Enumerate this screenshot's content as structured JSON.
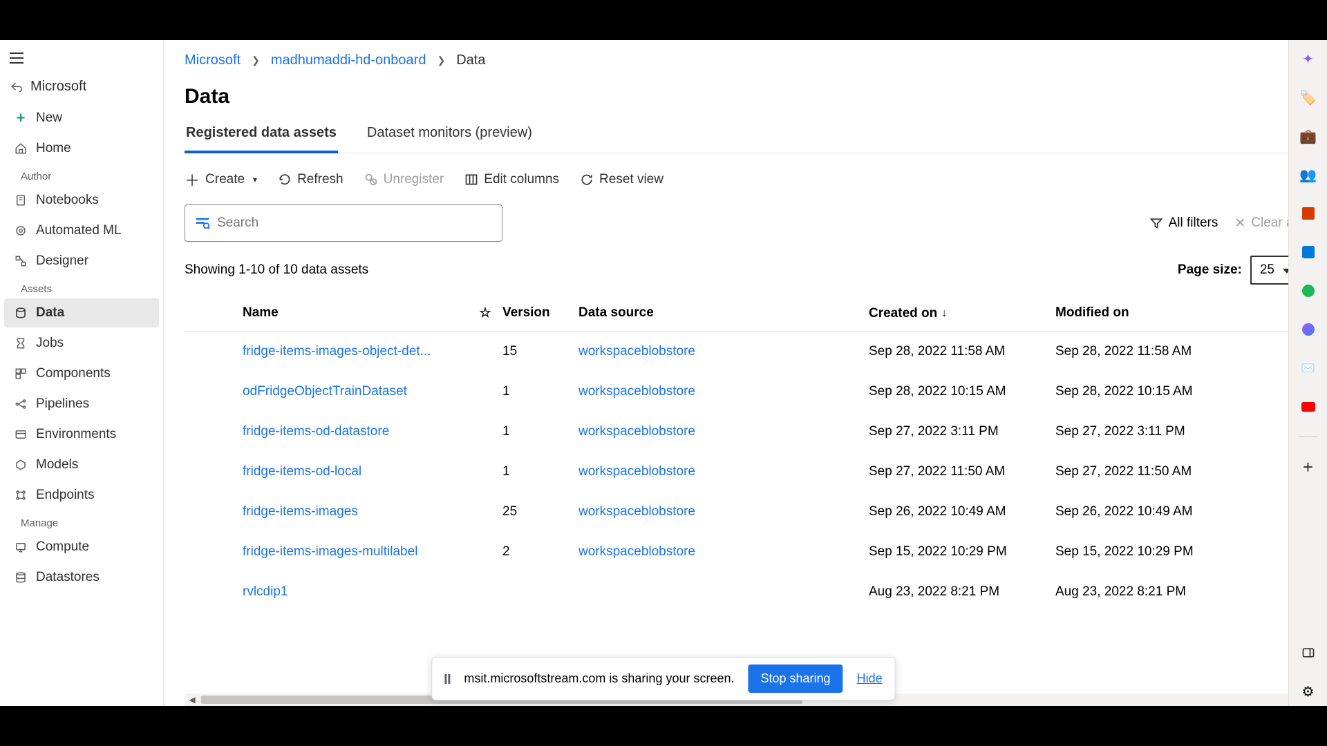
{
  "breadcrumb": {
    "root": "Microsoft",
    "workspace": "madhumaddi-hd-onboard",
    "current": "Data"
  },
  "page": {
    "title": "Data"
  },
  "tabs": [
    {
      "label": "Registered data assets",
      "active": true
    },
    {
      "label": "Dataset monitors (preview)",
      "active": false
    }
  ],
  "toolbar": {
    "create": "Create",
    "refresh": "Refresh",
    "unregister": "Unregister",
    "edit_columns": "Edit columns",
    "reset_view": "Reset view"
  },
  "search": {
    "placeholder": "Search"
  },
  "filters": {
    "all": "All filters",
    "clear": "Clear all"
  },
  "count_text": "Showing 1-10 of 10 data assets",
  "page_size": {
    "label": "Page size:",
    "value": "25"
  },
  "columns": {
    "name": "Name",
    "version": "Version",
    "data_source": "Data source",
    "created": "Created on",
    "modified": "Modified on"
  },
  "rows": [
    {
      "name": "fridge-items-images-object-det...",
      "version": "15",
      "ds": "workspaceblobstore",
      "created": "Sep 28, 2022 11:58 AM",
      "modified": "Sep 28, 2022 11:58 AM"
    },
    {
      "name": "odFridgeObjectTrainDataset",
      "version": "1",
      "ds": "workspaceblobstore",
      "created": "Sep 28, 2022 10:15 AM",
      "modified": "Sep 28, 2022 10:15 AM"
    },
    {
      "name": "fridge-items-od-datastore",
      "version": "1",
      "ds": "workspaceblobstore",
      "created": "Sep 27, 2022 3:11 PM",
      "modified": "Sep 27, 2022 3:11 PM"
    },
    {
      "name": "fridge-items-od-local",
      "version": "1",
      "ds": "workspaceblobstore",
      "created": "Sep 27, 2022 11:50 AM",
      "modified": "Sep 27, 2022 11:50 AM"
    },
    {
      "name": "fridge-items-images",
      "version": "25",
      "ds": "workspaceblobstore",
      "created": "Sep 26, 2022 10:49 AM",
      "modified": "Sep 26, 2022 10:49 AM"
    },
    {
      "name": "fridge-items-images-multilabel",
      "version": "2",
      "ds": "workspaceblobstore",
      "created": "Sep 15, 2022 10:29 PM",
      "modified": "Sep 15, 2022 10:29 PM"
    },
    {
      "name": "rvlcdip1",
      "version": "",
      "ds": "",
      "created": "Aug 23, 2022 8:21 PM",
      "modified": "Aug 23, 2022 8:21 PM"
    }
  ],
  "sidebar": {
    "back": "Microsoft",
    "new": "New",
    "home": "Home",
    "section_author": "Author",
    "notebooks": "Notebooks",
    "automl": "Automated ML",
    "designer": "Designer",
    "section_assets": "Assets",
    "data": "Data",
    "jobs": "Jobs",
    "components": "Components",
    "pipelines": "Pipelines",
    "environments": "Environments",
    "models": "Models",
    "endpoints": "Endpoints",
    "section_manage": "Manage",
    "compute": "Compute",
    "datastores": "Datastores"
  },
  "share": {
    "text": "msit.microsoftstream.com is sharing your screen.",
    "stop": "Stop sharing",
    "hide": "Hide"
  }
}
